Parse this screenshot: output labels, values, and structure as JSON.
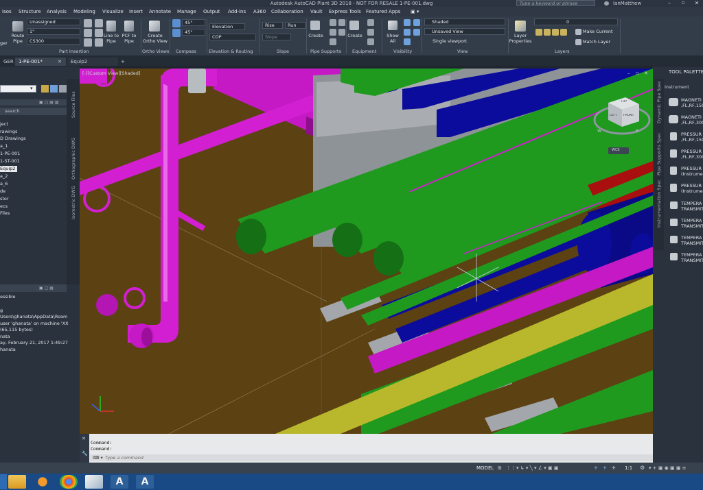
{
  "window": {
    "title": "Autodesk AutoCAD Plant 3D 2018 - NOT FOR RESALE  1-PE-001.dwg",
    "search_placeholder": "Type a keyword or phrase",
    "user": "IanMatthew"
  },
  "menu": [
    "Isos",
    "Structure",
    "Analysis",
    "Modeling",
    "Visualize",
    "Insert",
    "Annotate",
    "Manage",
    "Output",
    "Add-ins",
    "A360",
    "Collaboration",
    "Vault",
    "Express Tools",
    "Featured Apps"
  ],
  "ribbon": {
    "part_insertion": {
      "dropdown1": "Unassigned",
      "dropdown2": "1\"",
      "dropdown3": "CS300",
      "route_pipe": "Route\nPipe",
      "line_to_pipe": "Line to\nPipe",
      "pcf_to_pipe": "PCF to\nPipe",
      "label": "Part Insertion",
      "left_frag": "ger"
    },
    "ortho": {
      "create": "Create\nOrtho View",
      "label": "Ortho Views"
    },
    "compass": {
      "angle1": "45°",
      "angle2": "45°",
      "label": "Compass"
    },
    "elevation": {
      "elevation": "Elevation",
      "cop": "COP",
      "label": "Elevation & Routing"
    },
    "slope": {
      "rise": "Rise",
      "run": "Run",
      "slope": "Slope",
      "label": "Slope"
    },
    "pipe_supports": {
      "create": "Create",
      "label": "Pipe Supports"
    },
    "equipment": {
      "create": "Create",
      "label": "Equipment"
    },
    "visibility": {
      "show_all": "Show\nAll",
      "label": "Visibility"
    },
    "view": {
      "visual_style": "Shaded",
      "named_view": "Unsaved View",
      "viewport": "Single viewport",
      "label": "View"
    },
    "layers": {
      "properties": "Layer\nProperties",
      "layer_value": "0",
      "make_current": "Make Current",
      "match_layer": "Match Layer",
      "label": "Layers"
    }
  },
  "doc_tabs": [
    "GER",
    "1-PE-001*",
    "Equip2"
  ],
  "left_panel": {
    "search_placeholder": "search",
    "tree": [
      "ject",
      "rawings",
      "D Drawings",
      "a_1",
      "1-PE-001",
      "1-ST-001",
      "Equip2",
      "a_2",
      "a_6",
      "de",
      "ster",
      "ecs",
      "Files"
    ],
    "vertical_tabs": [
      "Source Files",
      "Orthographic DWG",
      "Isometric DWG"
    ],
    "details": [
      "essible",
      "g",
      "Users\\ghanata\\AppData\\Roam",
      "user 'ghanata' on machine 'XX",
      "(65,115 bytes)",
      "nata",
      "ay, February 21, 2017 1:49:27",
      "hanata"
    ]
  },
  "viewport": {
    "label": "[-][Custom View][Shaded]",
    "viewcube": {
      "top": "TOP",
      "front": "FRONT",
      "left": "LEFT",
      "compass_w": "W",
      "compass_s": "S",
      "wcs": "WCS"
    }
  },
  "right_panel": {
    "title": "TOOL PALETTES",
    "category": "Instrument",
    "items": [
      [
        "MAGNETI",
        ",FL,RF,150"
      ],
      [
        "MAGNETI",
        ",FL,RF,300"
      ],
      [
        "PRESSUR",
        ",FL,RF,150"
      ],
      [
        "PRESSUR",
        ",FL,RF,300"
      ],
      [
        "PRESSUR",
        "(Instrume"
      ],
      [
        "PRESSUR",
        "(Instrume"
      ],
      [
        "TEMPERA",
        "TRANSMIT"
      ],
      [
        "TEMPERA",
        "TRANSMIT"
      ],
      [
        "TEMPERA",
        "TRANSMIT"
      ],
      [
        "TEMPERA",
        "TRANSMIT"
      ]
    ],
    "vertical_tabs": [
      "Dynamic Pipe Spec",
      "Pipe Supports Spec",
      "Instrumentation Spec"
    ]
  },
  "command": {
    "history1": "Command:",
    "history2": "Command:",
    "placeholder": "Type a command"
  },
  "status": {
    "model": "MODEL",
    "scale": "1:1"
  },
  "colors": {
    "magenta": "#d11fd1",
    "green": "#1f9a1f",
    "blue": "#0c0c9c",
    "yellow": "#b9b82c",
    "red": "#a90f0f",
    "steel": "#9ea3a8",
    "background": "#5c4112"
  }
}
